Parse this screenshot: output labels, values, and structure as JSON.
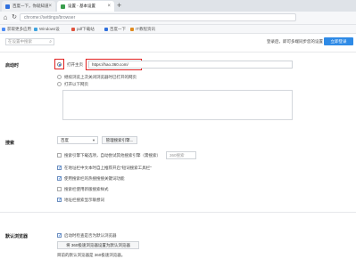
{
  "tabs": [
    {
      "label": "百度一下，你就知道",
      "active": false
    },
    {
      "label": "设置 - 基本设置",
      "active": true
    }
  ],
  "new_tab_symbol": "+",
  "address": {
    "url": "chrome://settings/browser"
  },
  "bookmarks": [
    {
      "label": "获取更多应用"
    },
    {
      "label": "Windows设"
    },
    {
      "label": "pdf下载站"
    },
    {
      "label": "百度一下"
    },
    {
      "label": "IT教程资讯"
    }
  ],
  "search": {
    "placeholder": "在设置中搜索"
  },
  "header": {
    "hint": "登录后，即可多端同步您的设置",
    "login_label": "立即登录"
  },
  "startup": {
    "title": "启动时",
    "option_open_home": "打开主页",
    "home_url": "https://hao.360.com/",
    "option_restore": "继续浏览上次关闭浏览器时已打开的网页",
    "option_open_pages": "打开以下网页"
  },
  "search_section": {
    "title": "搜索",
    "engine_value": "百度",
    "manage_label": "管理搜索引擎...",
    "opt1": "搜索引擎下载选项，自动尝试其他搜索引擎（需搜索）",
    "opt1_suffix": "360搜索",
    "opt2": "在地址栏中文本时自上推荐开启\"短词搜索工具栏\"",
    "opt3": "使用搜索栏的热搜搜搜关键词功能",
    "opt4": "搜索栏使用新版搜索样式",
    "opt5": "地址栏搜索显示联想词"
  },
  "default_browser": {
    "title": "默认浏览器",
    "opt_check": "启动时检查是否为默认浏览器",
    "set_default_label": "将 360极速浏览器设置为默认浏览器",
    "status": "目前的默认浏览器是 360极速浏览器。"
  },
  "colors": {
    "accent": "#2e8ae6",
    "highlight_border": "#e02020"
  }
}
